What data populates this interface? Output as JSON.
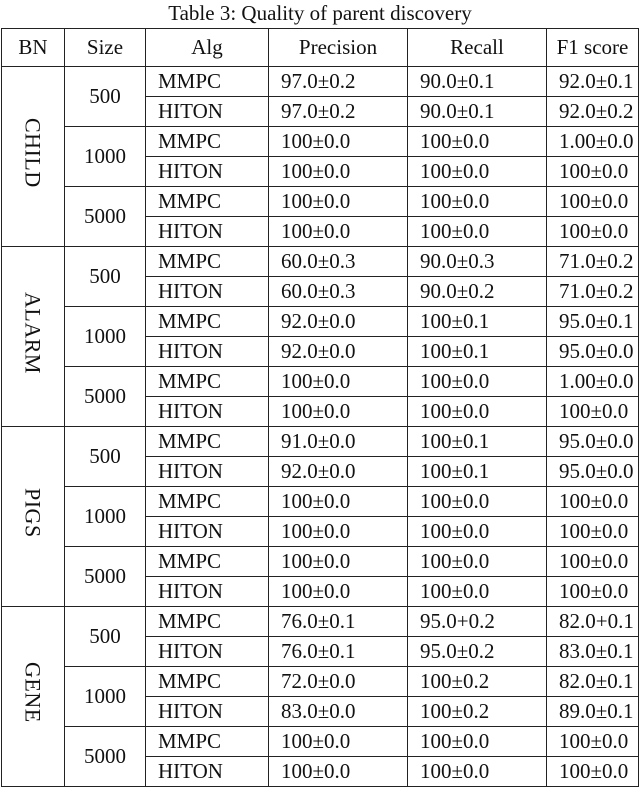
{
  "caption": "Table 3: Quality of parent discovery",
  "headers": [
    "BN",
    "Size",
    "Alg",
    "Precision",
    "Recall",
    "F1 score"
  ],
  "groups": [
    {
      "bn": "CHILD",
      "sizes": [
        {
          "size": "500",
          "rows": [
            {
              "alg": "MMPC",
              "precision": "97.0±0.2",
              "recall": "90.0±0.1",
              "f1": "92.0±0.1",
              "bold": false
            },
            {
              "alg": "HITON",
              "precision": "97.0±0.2",
              "recall": "90.0±0.1",
              "f1": "92.0±0.2",
              "bold": false
            }
          ]
        },
        {
          "size": "1000",
          "rows": [
            {
              "alg": "MMPC",
              "precision": "100±0.0",
              "recall": "100±0.0",
              "f1": "1.00±0.0",
              "bold": false
            },
            {
              "alg": "HITON",
              "precision": "100±0.0",
              "recall": "100±0.0",
              "f1": "100±0.0",
              "bold": false
            }
          ]
        },
        {
          "size": "5000",
          "rows": [
            {
              "alg": "MMPC",
              "precision": "100±0.0",
              "recall": "100±0.0",
              "f1": "100±0.0",
              "bold": true
            },
            {
              "alg": "HITON",
              "precision": "100±0.0",
              "recall": "100±0.0",
              "f1": "100±0.0",
              "bold": true
            }
          ]
        }
      ]
    },
    {
      "bn": "ALARM",
      "sizes": [
        {
          "size": "500",
          "rows": [
            {
              "alg": "MMPC",
              "precision": "60.0±0.3",
              "recall": "90.0±0.3",
              "f1": "71.0±0.2",
              "bold": false
            },
            {
              "alg": "HITON",
              "precision": "60.0±0.3",
              "recall": "90.0±0.2",
              "f1": "71.0±0.2",
              "bold": false
            }
          ]
        },
        {
          "size": "1000",
          "rows": [
            {
              "alg": "MMPC",
              "precision": "92.0±0.0",
              "recall": "100±0.1",
              "f1": "95.0±0.1",
              "bold": false
            },
            {
              "alg": "HITON",
              "precision": "92.0±0.0",
              "recall": "100±0.1",
              "f1": "95.0±0.0",
              "bold": false
            }
          ]
        },
        {
          "size": "5000",
          "rows": [
            {
              "alg": "MMPC",
              "precision": "100±0.0",
              "recall": "100±0.0",
              "f1": "1.00±0.0",
              "bold": true
            },
            {
              "alg": "HITON",
              "precision": "100±0.0",
              "recall": "100±0.0",
              "f1": "100±0.0",
              "bold": true
            }
          ]
        }
      ]
    },
    {
      "bn": "PIGS",
      "sizes": [
        {
          "size": "500",
          "rows": [
            {
              "alg": "MMPC",
              "precision": "91.0±0.0",
              "recall": "100±0.1",
              "f1": "95.0±0.0",
              "bold": false
            },
            {
              "alg": "HITON",
              "precision": "92.0±0.0",
              "recall": "100±0.1",
              "f1": "95.0±0.0",
              "bold": false
            }
          ]
        },
        {
          "size": "1000",
          "rows": [
            {
              "alg": "MMPC",
              "precision": "100±0.0",
              "recall": "100±0.0",
              "f1": "100±0.0",
              "bold": false
            },
            {
              "alg": "HITON",
              "precision": "100±0.0",
              "recall": "100±0.0",
              "f1": "100±0.0",
              "bold": false
            }
          ]
        },
        {
          "size": "5000",
          "rows": [
            {
              "alg": "MMPC",
              "precision": "100±0.0",
              "recall": "100±0.0",
              "f1": "100±0.0",
              "bold": true
            },
            {
              "alg": "HITON",
              "precision": "100±0.0",
              "recall": "100±0.0",
              "f1": "100±0.0",
              "bold": true
            }
          ]
        }
      ]
    },
    {
      "bn": "GENE",
      "sizes": [
        {
          "size": "500",
          "rows": [
            {
              "alg": "MMPC",
              "precision": "76.0±0.1",
              "recall": "95.0+0.2",
              "f1": "82.0+0.1",
              "bold": false
            },
            {
              "alg": "HITON",
              "precision": "76.0±0.1",
              "recall": "95.0±0.2",
              "f1": "83.0±0.1",
              "bold": false
            }
          ]
        },
        {
          "size": "1000",
          "rows": [
            {
              "alg": "MMPC",
              "precision": "72.0±0.0",
              "recall": "100±0.2",
              "f1": "82.0±0.1",
              "bold": false
            },
            {
              "alg": "HITON",
              "precision": "83.0±0.0",
              "recall": "100±0.2",
              "f1": "89.0±0.1",
              "bold": false
            }
          ]
        },
        {
          "size": "5000",
          "rows": [
            {
              "alg": "MMPC",
              "precision": "100±0.0",
              "recall": "100±0.0",
              "f1": "100±0.0",
              "bold": true
            },
            {
              "alg": "HITON",
              "precision": "100±0.0",
              "recall": "100±0.0",
              "f1": "100±0.0",
              "bold": true
            }
          ]
        }
      ]
    }
  ]
}
